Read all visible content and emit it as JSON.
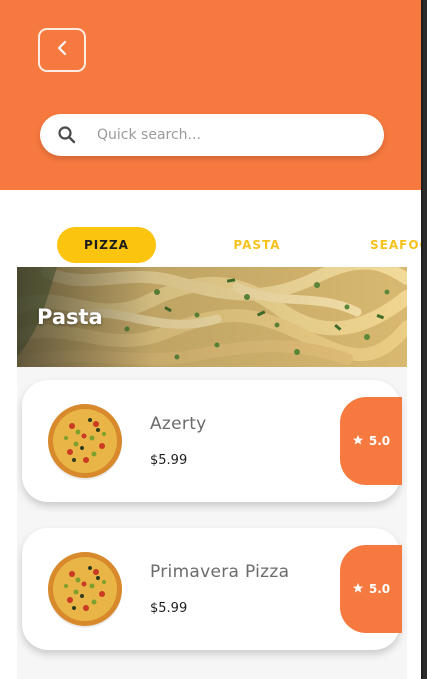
{
  "header": {
    "back_icon": "chevron-left-icon",
    "accent_color": "#f6793f"
  },
  "search": {
    "icon": "search-icon",
    "placeholder": "Quick search...",
    "value": ""
  },
  "tabs": [
    {
      "label": "PIZZA",
      "active": true
    },
    {
      "label": "PASTA",
      "active": false
    },
    {
      "label": "SEAFOOD",
      "active": false
    }
  ],
  "banner": {
    "title": "Pasta"
  },
  "items": [
    {
      "name": "Azerty",
      "price": "$5.99",
      "rating": "5.0",
      "rating_icon": "star-icon"
    },
    {
      "name": "Primavera Pizza",
      "price": "$5.99",
      "rating": "5.0",
      "rating_icon": "star-icon"
    }
  ],
  "colors": {
    "accent": "#f6793f",
    "tab_active": "#fbc40f",
    "tab_inactive": "#f7c21b"
  }
}
